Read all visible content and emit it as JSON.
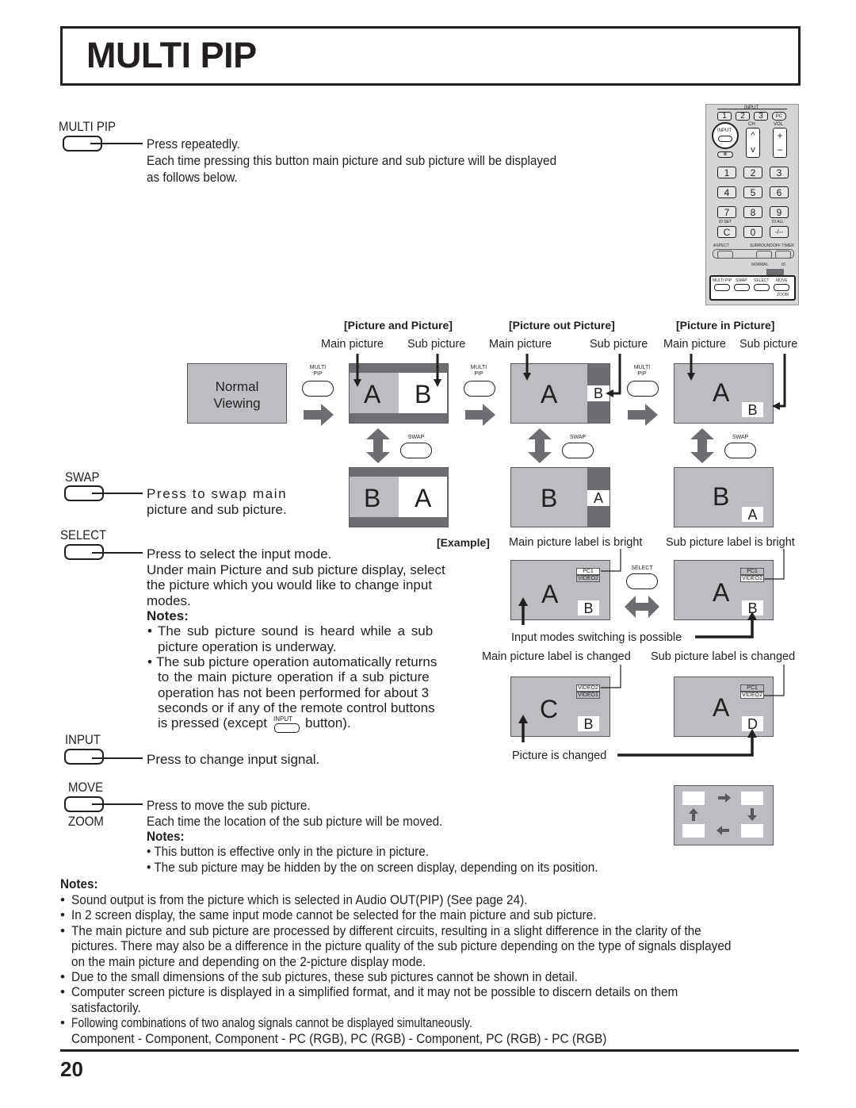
{
  "page_title": "MULTI PIP",
  "page_number": "20",
  "colors": {
    "text": "#231f20",
    "screen_gray": "#bcbdc0",
    "bar_dark": "#6d6e71",
    "arrow_gray": "#6d6e71"
  },
  "remote": {
    "input_group_label": "INPUT",
    "top_keys": [
      "1",
      "2",
      "3",
      "PC"
    ],
    "input_key_label": "INPUT",
    "ch_label": "CH",
    "vol_label": "VOL",
    "ch_up": "^",
    "ch_down": "v",
    "vol_plus": "+",
    "vol_minus": "−",
    "mute_label": "⊗",
    "num_keys": [
      "1",
      "2",
      "3",
      "4",
      "5",
      "6",
      "7",
      "8",
      "9",
      "C",
      "0",
      "-/--"
    ],
    "id_set_label": "ID SET",
    "id_all_label": "ID ALL",
    "aspect_label": "ASPECT",
    "surround_label": "SURROUND",
    "off_timer_label": "OFF TIMER",
    "normal_label": "NORMAL",
    "id_label": "ID",
    "bottom_keys": [
      "MULTI PIP",
      "SWAP",
      "SELECT",
      "MOVE"
    ],
    "zoom_label": "ZOOM"
  },
  "sections": {
    "multi_pip": {
      "button_label": "MULTI PIP",
      "lines": [
        "Press repeatedly.",
        "Each time pressing this button main picture and sub picture will be displayed",
        "as follows below."
      ]
    },
    "swap": {
      "button_label": "SWAP",
      "lines": [
        "Press to swap main",
        "picture and sub picture."
      ]
    },
    "select": {
      "button_label": "SELECT",
      "lines": [
        "Press to select the input mode.",
        "Under main Picture and sub picture display, select",
        "the picture which you would like to change input",
        "modes."
      ],
      "notes_heading": "Notes:",
      "notes": [
        [
          "The sub picture sound is heard while a sub",
          "picture operation is underway."
        ],
        [
          "The sub picture operation automatically returns",
          "to the main picture operation if a sub picture",
          "operation has not been performed for about 3",
          "seconds or if any of the remote control buttons",
          "is pressed (except",
          "button)."
        ]
      ],
      "inline_key_label": "INPUT"
    },
    "input": {
      "button_label": "INPUT",
      "lines": [
        "Press to change input signal."
      ]
    },
    "move": {
      "button_label": "MOVE",
      "button_sublabel": "ZOOM",
      "lines": [
        "Press to move the sub picture.",
        "Each time the location of the sub picture will be moved."
      ],
      "notes_heading": "Notes:",
      "notes": [
        "This button is effective only in the picture in picture.",
        "The sub picture may be hidden by the on screen display, depending on its position."
      ]
    }
  },
  "diagram": {
    "normal_viewing": [
      "Normal",
      "Viewing"
    ],
    "modes": [
      {
        "title": "[Picture and Picture]",
        "main_label": "Main picture",
        "sub_label": "Sub picture",
        "top": [
          "A",
          "B"
        ],
        "bottom": [
          "B",
          "A"
        ]
      },
      {
        "title": "[Picture out Picture]",
        "main_label": "Main picture",
        "sub_label": "Sub picture",
        "top": [
          "A",
          "B"
        ],
        "bottom": [
          "B",
          "A"
        ]
      },
      {
        "title": "[Picture in Picture]",
        "main_label": "Main picture",
        "sub_label": "Sub picture",
        "top": [
          "A",
          "B"
        ],
        "bottom": [
          "B",
          "A"
        ]
      }
    ],
    "multi_key_label_1": "MULTI",
    "multi_key_label_2": "PIP",
    "swap_key_label": "SWAP",
    "select_key_label": "SELECT"
  },
  "example": {
    "heading": "[Example]",
    "main_bright_caption": "Main picture label is bright",
    "sub_bright_caption": "Sub picture label is bright",
    "switching_caption": "Input modes switching is possible",
    "main_changed_caption": "Main picture label is changed",
    "sub_changed_caption": "Sub picture label is changed",
    "picture_changed_caption": "Picture is changed",
    "screens": [
      {
        "main": "A",
        "sub": "B",
        "osd": [
          "PC1",
          "VIDEO2"
        ]
      },
      {
        "main": "A",
        "sub": "B",
        "osd": [
          "PC1",
          "VIDEO2"
        ]
      },
      {
        "main": "C",
        "sub": "B",
        "osd": [
          "VIDEO2",
          "VIDEO1"
        ]
      },
      {
        "main": "A",
        "sub": "D",
        "osd": [
          "PC1",
          "VIDEO2"
        ]
      }
    ]
  },
  "general_notes": {
    "heading": "Notes:",
    "items": [
      [
        "Sound output is from the picture which is selected in Audio OUT(PIP) (See page 24)."
      ],
      [
        "In 2 screen display, the same input mode cannot be selected for the main picture and sub picture."
      ],
      [
        "The main picture and sub picture are processed by different circuits, resulting in a slight difference in the clarity of the",
        "pictures. There may also be a difference in the picture quality of the sub picture depending on the type of signals displayed",
        "on the main picture and depending on the 2-picture display mode."
      ],
      [
        "Due to the small dimensions of the sub pictures, these sub pictures cannot be shown in detail."
      ],
      [
        "Computer screen picture is displayed in a simplified format, and it may not be possible to discern details on them",
        "satisfactorily."
      ],
      [
        "Following combinations of two analog signals cannot be displayed simultaneously.",
        "Component - Component, Component - PC (RGB), PC (RGB) - Component, PC (RGB) - PC (RGB)"
      ]
    ]
  }
}
